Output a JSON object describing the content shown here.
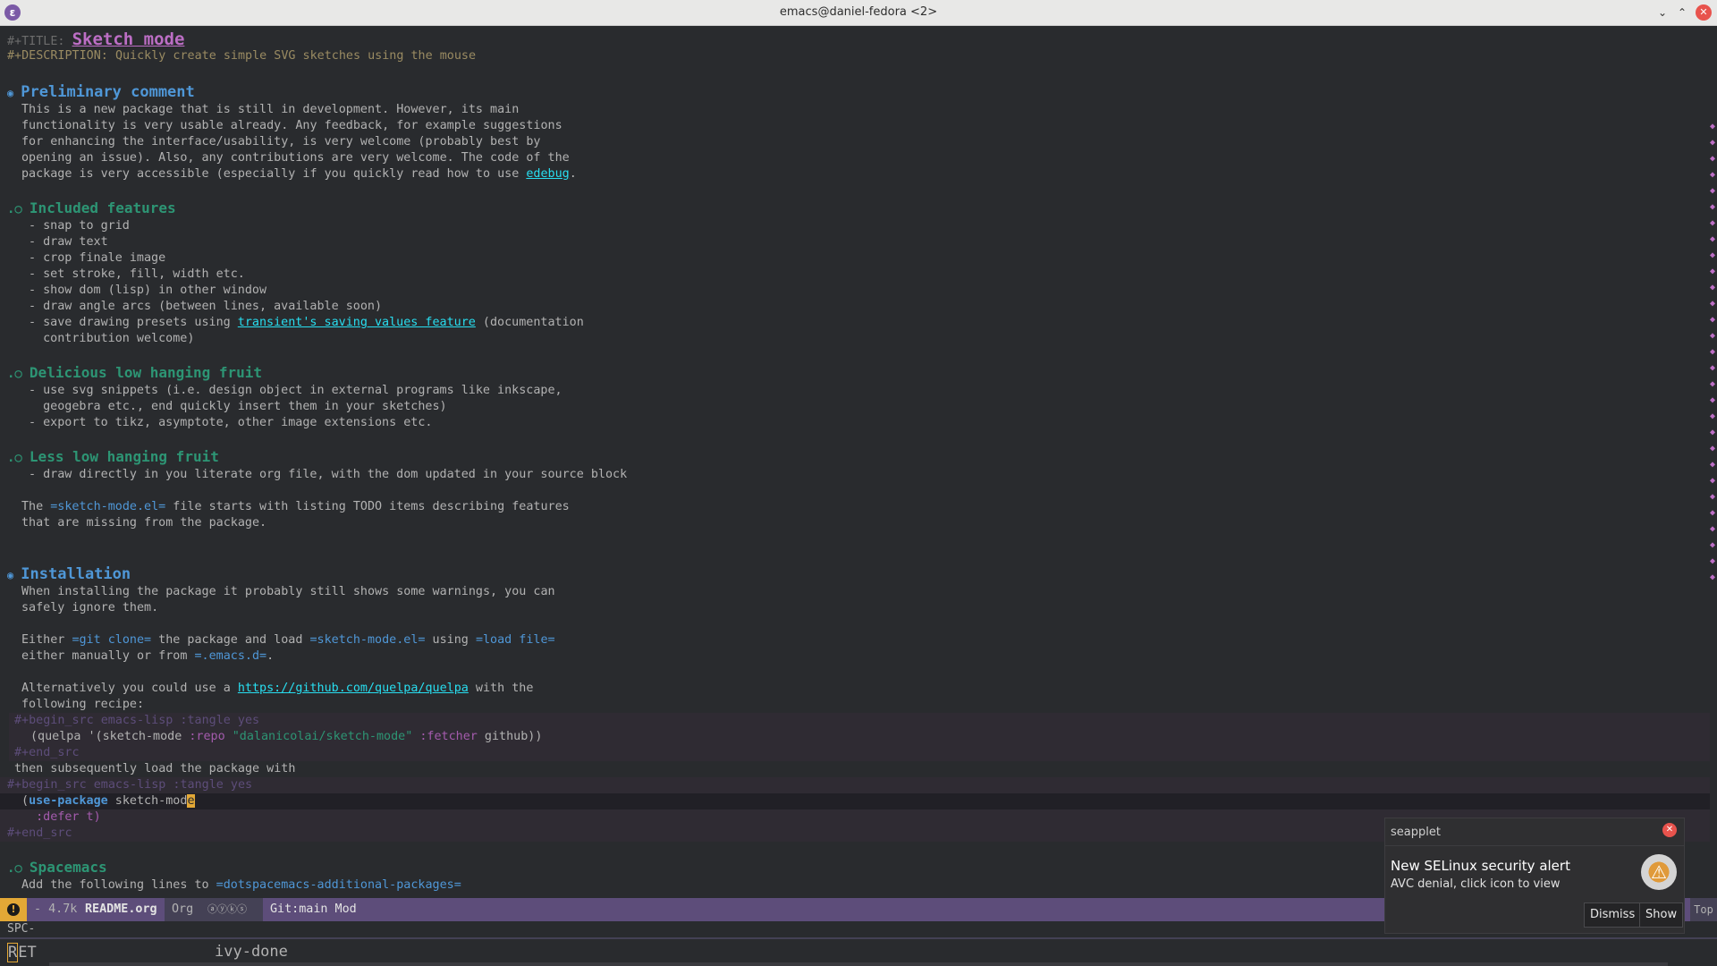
{
  "window": {
    "title": "emacs@daniel-fedora <2>",
    "app_icon": "emacs-icon"
  },
  "doc": {
    "title_kw": "#+TITLE: ",
    "title": "Sketch mode",
    "desc_kw": "#+DESCRIPTION: ",
    "desc": "Quickly create simple SVG sketches using the mouse",
    "h_prelim": "Preliminary comment",
    "prelim": [
      "This is a new package that is still in development. However, its main",
      "functionality is very usable already. Any feedback, for example suggestions",
      "for enhancing the interface/usability, is very welcome (probably best by",
      "opening an issue). Also, any contributions are very welcome. The code of the"
    ],
    "prelim_last_pre": "package is very accessible (especially if you quickly read how to use ",
    "prelim_last_link": "edebug",
    "prelim_last_post": ".",
    "h_features": "Included features",
    "features": [
      "- snap to grid",
      "- draw text",
      "- crop finale image",
      "- set stroke, fill, width etc.",
      "- show dom (lisp) in other window",
      "- draw angle arcs (between lines, available soon)"
    ],
    "feature_last_pre": "- save drawing presets using ",
    "feature_last_link": "transient's saving values feature",
    "feature_last_post": " (documentation",
    "feature_last_cont": "  contribution welcome)",
    "h_fruit": "Delicious low hanging fruit",
    "fruit": [
      "- use svg snippets (i.e. design object in external programs like inkscape,",
      "  geogebra etc., end quickly insert them in your sketches)",
      "- export to tikz, asymptote, other image extensions etc."
    ],
    "h_less": "Less low hanging fruit",
    "less": "- draw directly in you literate org file, with the dom updated in your source block",
    "todo_pre": "The ",
    "todo_code": "=sketch-mode.el=",
    "todo_post": " file starts with listing TODO items describing features",
    "todo_cont": "that are missing from the package.",
    "h_install": "Installation",
    "install1": "When installing the package it probably still shows some warnings, you can",
    "install2": "safely ignore them.",
    "either_1": "Either ",
    "either_code1": "=git clone=",
    "either_2": " the package and load ",
    "either_code2": "=sketch-mode.el=",
    "either_3": " using ",
    "either_code3": "=load file=",
    "either_cont_pre": "either manually or from ",
    "either_cont_code": "=.emacs.d=",
    "either_cont_post": ".",
    "alt_pre": "Alternatively you could use a ",
    "alt_link": "https://github.com/quelpa/quelpa",
    "alt_post": " with the",
    "alt_cont": "following recipe:",
    "src1_begin": "#+begin_src emacs-lisp :tangle yes",
    "src1_a": "(quelpa '(sketch-mode ",
    "src1_repo_kw": ":repo",
    "src1_repo_val": "\"dalanicolai/sketch-mode\"",
    "src1_fetcher_kw": " :fetcher",
    "src1_fetcher_val": " github))",
    "src1_end": "#+end_src",
    "then": "then subsequently load the package with",
    "src2_begin": "#+begin_src emacs-lisp :tangle yes",
    "src2_open": "(",
    "src2_kw": "use-package",
    "src2_pkg_pre": " sketch-mod",
    "src2_pkg_cursor": "e",
    "src2_defer": "  :defer t)",
    "src2_end": "#+end_src",
    "h_spacemacs": "Spacemacs",
    "spacemacs_pre": "Add the following lines to ",
    "spacemacs_code": "=dotspacemacs-additional-packages="
  },
  "bullets": {
    "h1": "◉",
    "h2": ".○"
  },
  "modeline": {
    "warn": "!",
    "size": "- 4.7k",
    "file": "README.org",
    "mode": "Org",
    "circles": "ⓐⓨⓚⓢ",
    "git": "Git:main Mod",
    "position": "Top"
  },
  "echo": {
    "prefix": "SPC-",
    "key_first": "R",
    "key_rest": "ET",
    "command": "ivy-done"
  },
  "notification": {
    "app": "seapplet",
    "title": "New SELinux security alert",
    "body": "AVC denial, click icon to view",
    "dismiss": "Dismiss",
    "show": "Show"
  },
  "colors": {
    "bg": "#292b2e",
    "heading1": "#4f97d7",
    "heading2": "#2d9574",
    "title": "#bc6ec5",
    "modeline": "#5d4d7a",
    "cursor": "#e3a836"
  }
}
